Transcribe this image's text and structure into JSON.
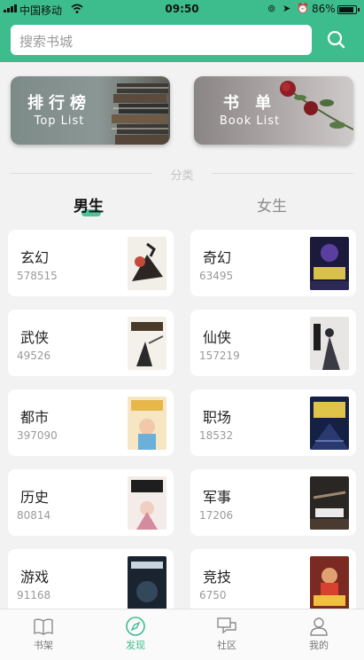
{
  "status_bar": {
    "carrier": "中国移动",
    "time": "09:50",
    "battery": "86%"
  },
  "search": {
    "placeholder": "搜索书城"
  },
  "banners": [
    {
      "title": "排行榜",
      "subtitle": "Top  List"
    },
    {
      "title": "书 单",
      "subtitle": "Book  List"
    }
  ],
  "section_label": "分类",
  "gender_tabs": [
    {
      "label": "男生",
      "active": true
    },
    {
      "label": "女生",
      "active": false
    }
  ],
  "categories": [
    {
      "name": "玄幻",
      "count": "578515"
    },
    {
      "name": "奇幻",
      "count": "63495"
    },
    {
      "name": "武侠",
      "count": "49526"
    },
    {
      "name": "仙侠",
      "count": "157219"
    },
    {
      "name": "都市",
      "count": "397090"
    },
    {
      "name": "职场",
      "count": "18532"
    },
    {
      "name": "历史",
      "count": "80814"
    },
    {
      "name": "军事",
      "count": "17206"
    },
    {
      "name": "游戏",
      "count": "91168"
    },
    {
      "name": "竞技",
      "count": "6750"
    }
  ],
  "bottom_tabs": [
    {
      "label": "书架",
      "icon": "book-icon",
      "active": false
    },
    {
      "label": "发现",
      "icon": "compass-icon",
      "active": true
    },
    {
      "label": "社区",
      "icon": "chat-icon",
      "active": false
    },
    {
      "label": "我的",
      "icon": "user-icon",
      "active": false
    }
  ],
  "colors": {
    "accent": "#3dbd8e",
    "background": "#f2f2f2"
  }
}
